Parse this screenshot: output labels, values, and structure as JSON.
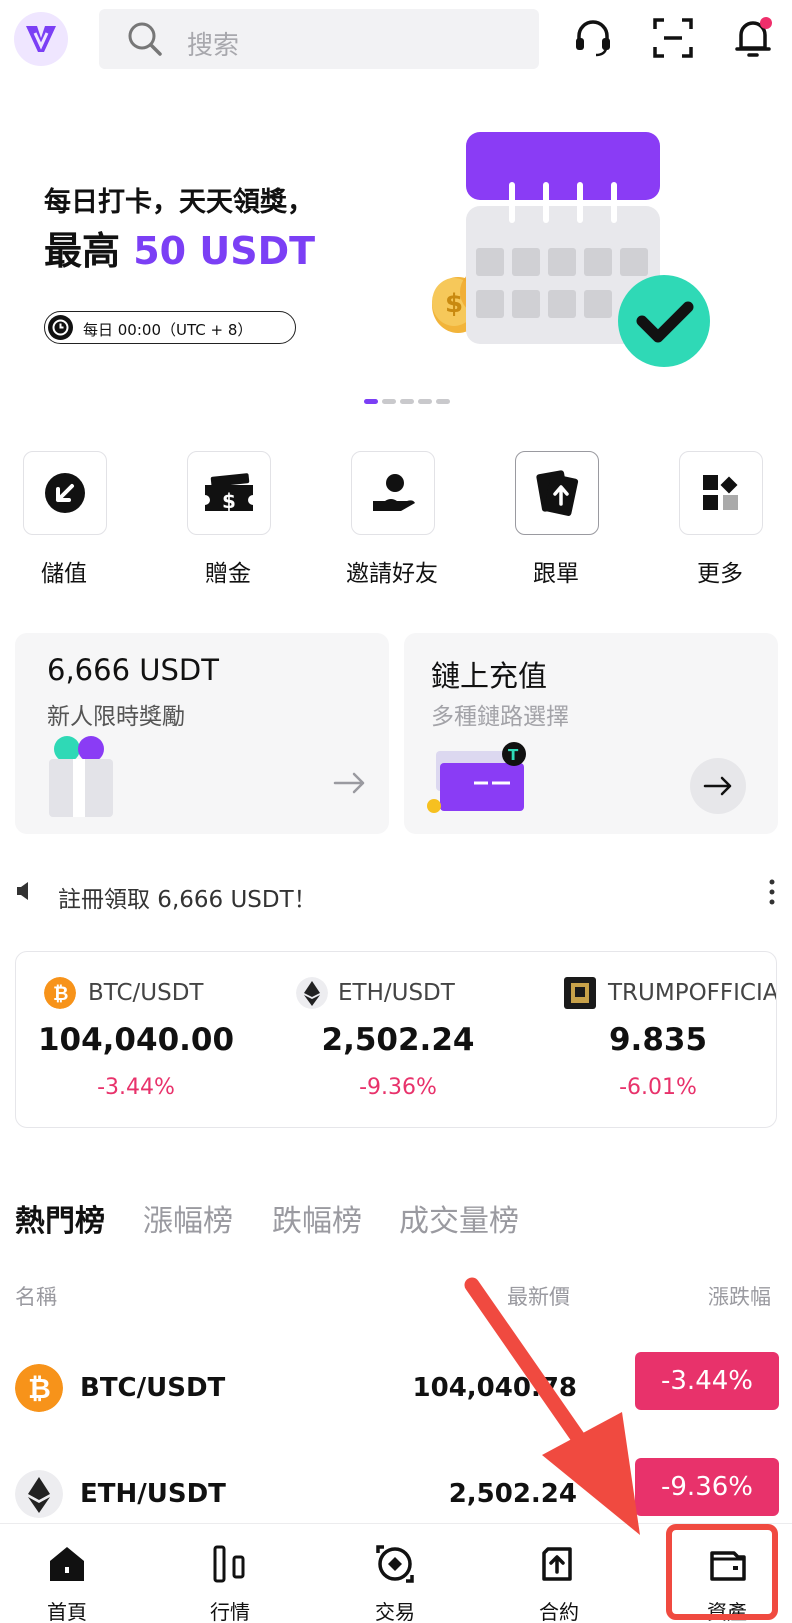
{
  "header": {
    "search_placeholder": "搜索"
  },
  "banner": {
    "line1": "每日打卡，天天領獎，",
    "line2_prefix": "最高 ",
    "line2_highlight": "50 USDT",
    "time_label": "每日 00:00（UTC + 8）",
    "slides_total": 5,
    "slide_active": 1
  },
  "quick_actions": [
    {
      "label": "儲值",
      "icon": "deposit-arrow-icon"
    },
    {
      "label": "贈金",
      "icon": "ticket-dollar-icon"
    },
    {
      "label": "邀請好友",
      "icon": "invite-hand-icon"
    },
    {
      "label": "跟單",
      "icon": "copy-trade-card-icon"
    },
    {
      "label": "更多",
      "icon": "more-grid-icon"
    }
  ],
  "cards": {
    "left": {
      "title": "6,666 USDT",
      "subtitle": "新人限時獎勵"
    },
    "right": {
      "title": "鏈上充值",
      "subtitle": "多種鏈路選擇"
    }
  },
  "notice": {
    "text": "註冊領取 6,666 USDT！"
  },
  "tickers": [
    {
      "pair": "BTC/USDT",
      "price": "104,040.00",
      "change": "-3.44%"
    },
    {
      "pair": "ETH/USDT",
      "price": "2,502.24",
      "change": "-9.36%"
    },
    {
      "pair": "TRUMPOFFICIAL",
      "price": "9.835",
      "change": "-6.01%"
    }
  ],
  "rank_tabs": [
    "熱門榜",
    "漲幅榜",
    "跌幅榜",
    "成交量榜"
  ],
  "list_headers": {
    "name": "名稱",
    "price": "最新價",
    "change": "漲跌幅"
  },
  "list_rows": [
    {
      "pair": "BTC/USDT",
      "price": "104,040.78",
      "change": "-3.44%"
    },
    {
      "pair": "ETH/USDT",
      "price": "2,502.24",
      "change": "-9.36%"
    }
  ],
  "bottom_nav": [
    {
      "label": "首頁",
      "icon": "home-icon"
    },
    {
      "label": "行情",
      "icon": "market-bars-icon"
    },
    {
      "label": "交易",
      "icon": "trade-swap-icon"
    },
    {
      "label": "合約",
      "icon": "contract-upload-icon"
    },
    {
      "label": "資產",
      "icon": "wallet-icon"
    }
  ],
  "colors": {
    "brand_purple": "#7b3ff5",
    "down_pink": "#e8326b",
    "annotation_red": "#f04a40",
    "notification_dot": "#ef2f6b"
  }
}
